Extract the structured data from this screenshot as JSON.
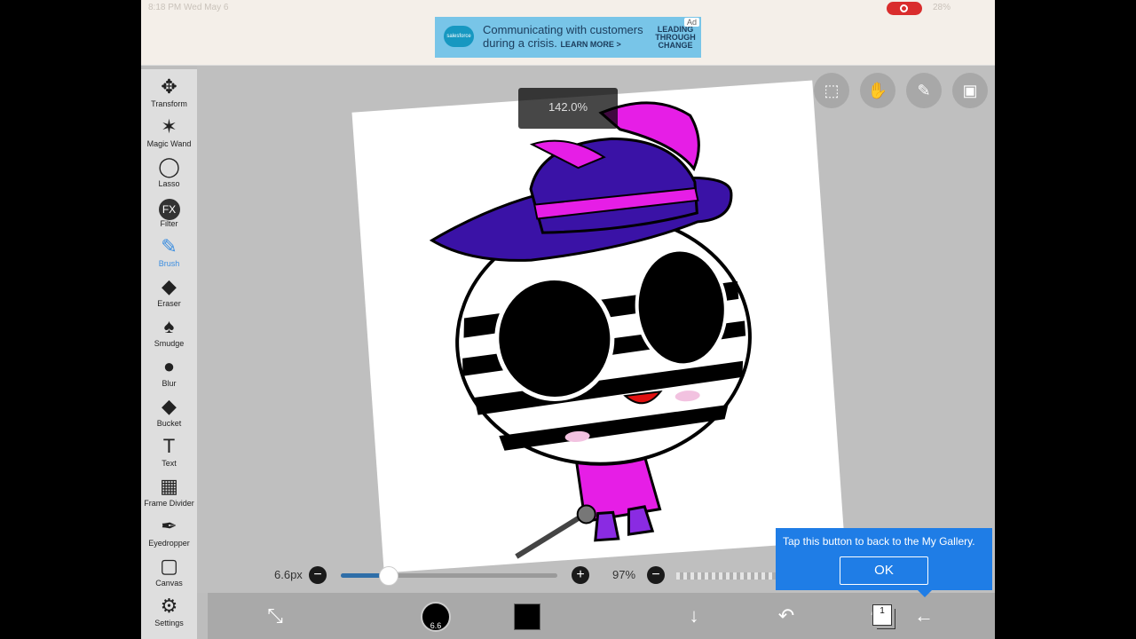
{
  "status": {
    "time": "8:18 PM   Wed May 6",
    "battery": "28%"
  },
  "ad": {
    "brand": "salesforce",
    "headline": "Communicating with customers during a crisis.",
    "cta": "LEARN MORE >",
    "tagline": "LEADING THROUGH CHANGE",
    "badge": "Ad"
  },
  "toolbar": {
    "items": [
      {
        "label": "Transform",
        "icon": "move-icon",
        "glyph": "✥"
      },
      {
        "label": "Magic Wand",
        "icon": "magic-wand-icon",
        "glyph": "✶"
      },
      {
        "label": "Lasso",
        "icon": "lasso-icon",
        "glyph": "◯"
      },
      {
        "label": "Filter",
        "icon": "fx-icon",
        "glyph": "FX"
      },
      {
        "label": "Brush",
        "icon": "brush-icon",
        "glyph": "✎",
        "active": true
      },
      {
        "label": "Eraser",
        "icon": "eraser-icon",
        "glyph": "◆"
      },
      {
        "label": "Smudge",
        "icon": "smudge-icon",
        "glyph": "♠"
      },
      {
        "label": "Blur",
        "icon": "drop-icon",
        "glyph": "●"
      },
      {
        "label": "Bucket",
        "icon": "bucket-icon",
        "glyph": "◆"
      },
      {
        "label": "Text",
        "icon": "text-icon",
        "glyph": "T"
      },
      {
        "label": "Frame Divider",
        "icon": "frame-divider-icon",
        "glyph": "▦"
      },
      {
        "label": "Eyedropper",
        "icon": "eyedropper-icon",
        "glyph": "✒"
      },
      {
        "label": "Canvas",
        "icon": "canvas-icon",
        "glyph": "▢"
      },
      {
        "label": "Settings",
        "icon": "gear-icon",
        "glyph": "⚙"
      }
    ]
  },
  "zoom": "142.0%",
  "top_buttons": [
    {
      "icon": "selection-icon",
      "glyph": "⬚"
    },
    {
      "icon": "hand-icon",
      "glyph": "✋"
    },
    {
      "icon": "ruler-icon",
      "glyph": "✎"
    },
    {
      "icon": "image-icon",
      "glyph": "▣"
    }
  ],
  "brush": {
    "size": "6.6px",
    "size_fraction": 0.22,
    "opacity": "97%",
    "preview_label": "6.6"
  },
  "tooltip": {
    "message": "Tap this button to back to the My Gallery.",
    "ok": "OK"
  },
  "bottombar": {
    "layer_count": "1",
    "icons": [
      "layers-swap-icon",
      "brush-preview",
      "color-chip",
      "download-icon",
      "undo-icon",
      "redo-icon",
      "layers-icon",
      "back-arrow-icon"
    ]
  },
  "colors": {
    "hat": "#3a12a6",
    "accent": "#e61ee6",
    "active_tool": "#3a8de0",
    "tooltip": "#1f7de6"
  }
}
